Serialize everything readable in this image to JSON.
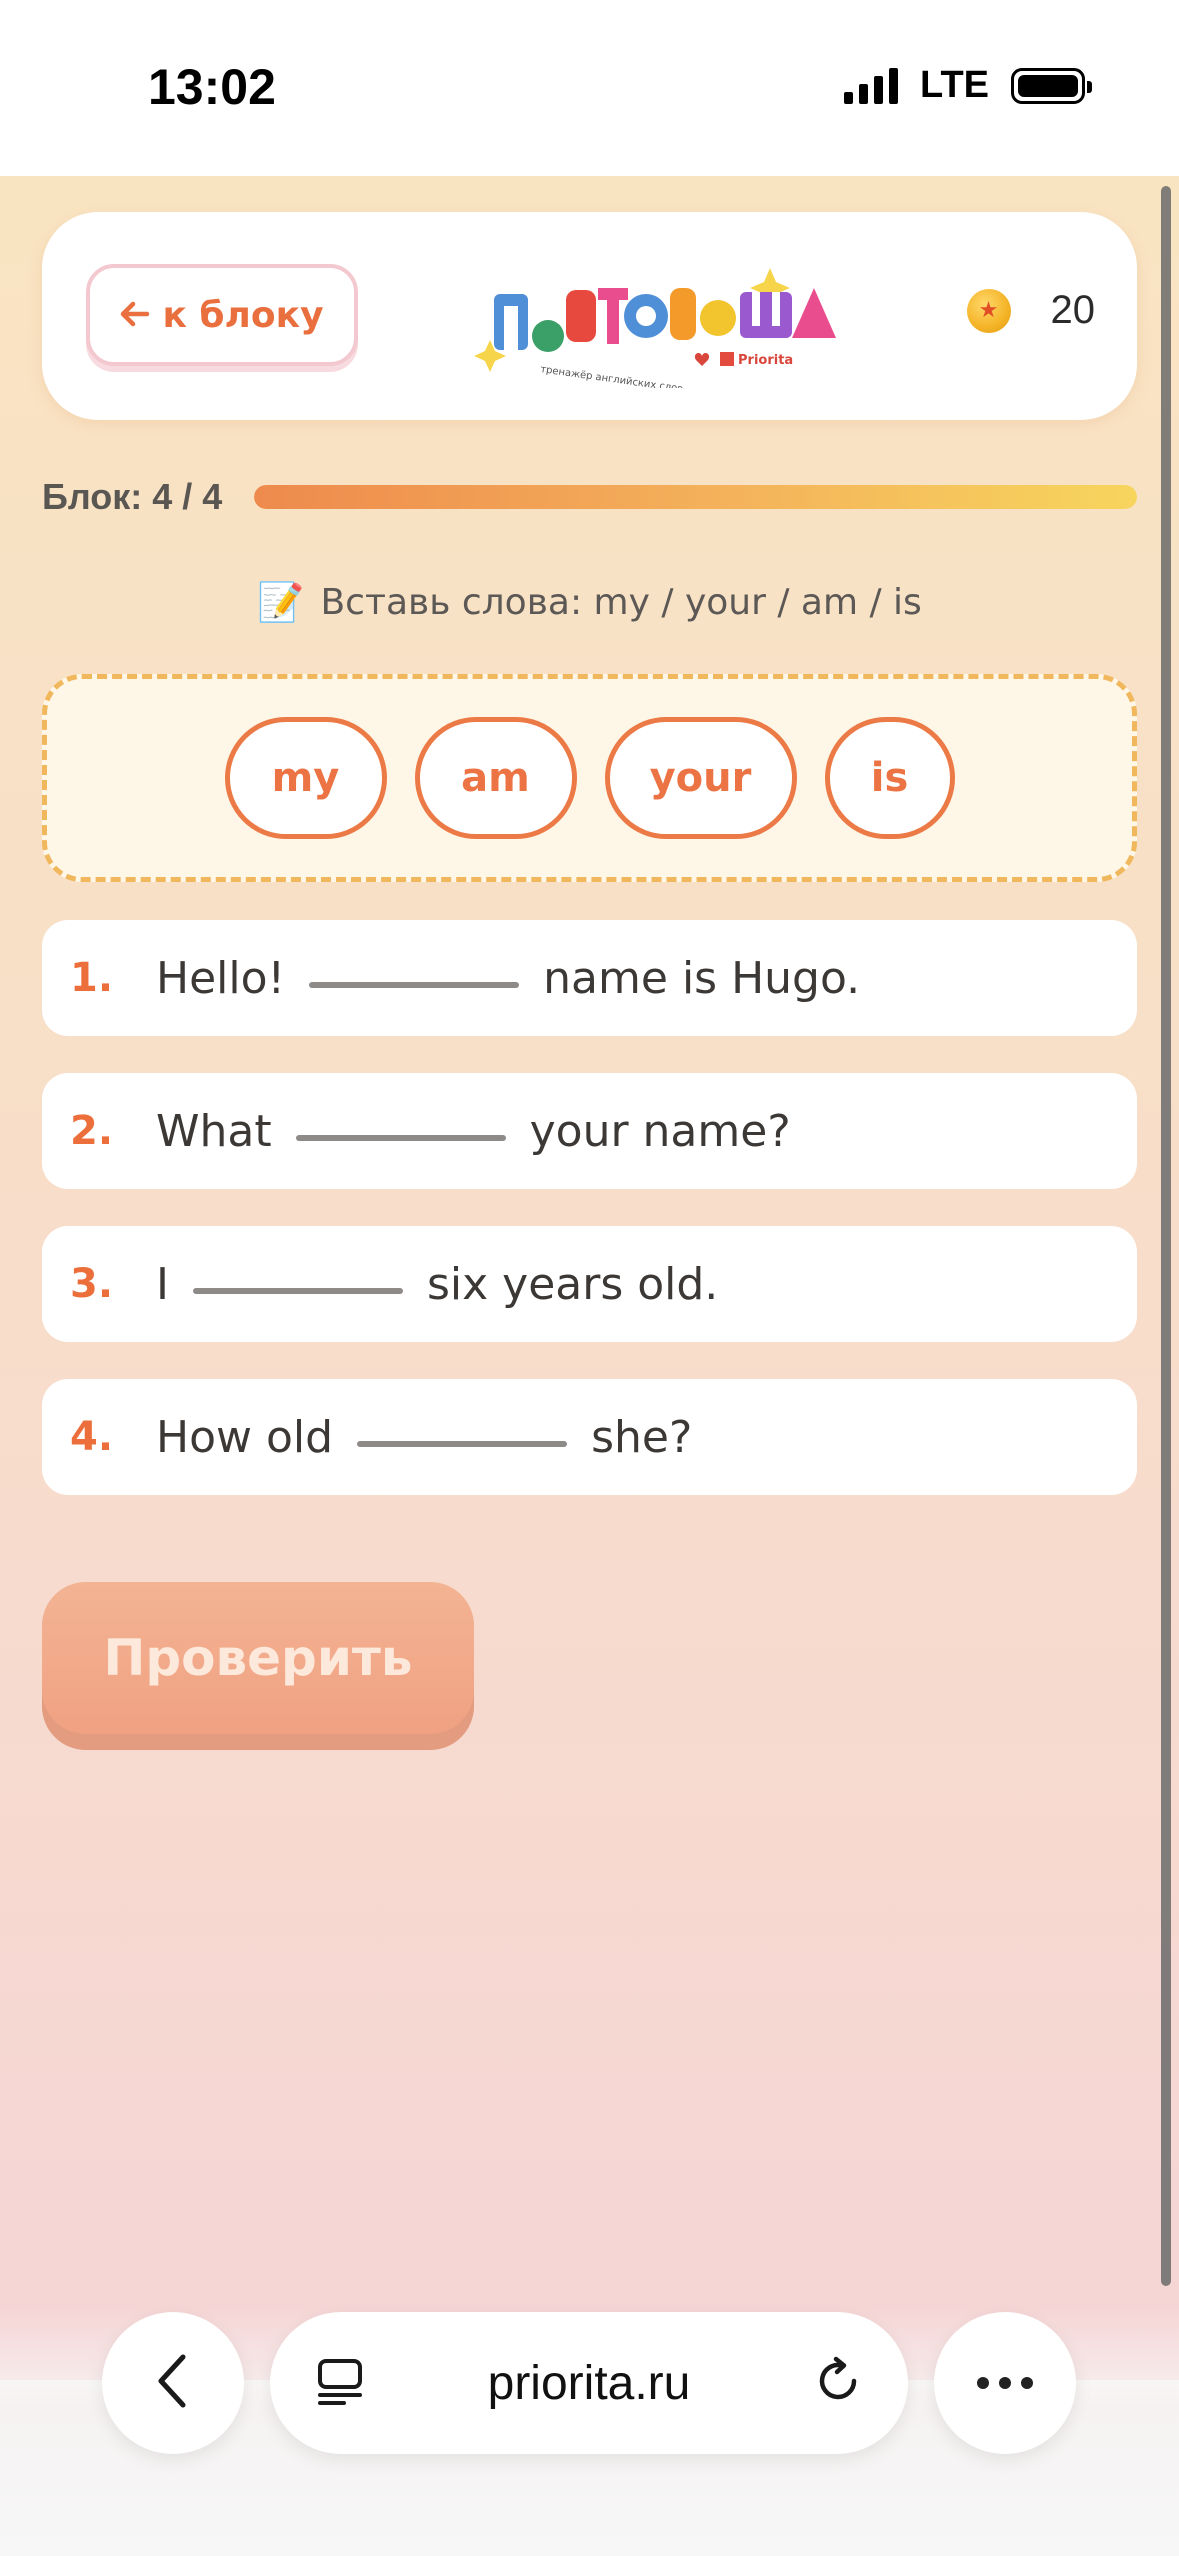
{
  "status_bar": {
    "time": "13:02",
    "network": "LTE"
  },
  "header": {
    "back_label": "к блоку",
    "logo_text": "ПОВТОРЮША",
    "coins": "20"
  },
  "progress": {
    "label": "Блок: 4 / 4",
    "fraction": 1.0
  },
  "instruction": "Вставь слова: my / your / am / is",
  "word_bank": [
    "my",
    "am",
    "your",
    "is"
  ],
  "sentences": [
    {
      "num": "1.",
      "before": "Hello!",
      "after": "name is Hugo."
    },
    {
      "num": "2.",
      "before": "What",
      "after": "your name?"
    },
    {
      "num": "3.",
      "before": "I",
      "after": "six years old."
    },
    {
      "num": "4.",
      "before": "How old",
      "after": "she?"
    }
  ],
  "check_button": "Проверить",
  "browser": {
    "url": "priorita.ru"
  },
  "colors": {
    "accent": "#ec7343",
    "chip_border": "#ec7a46",
    "wordbank_border": "#f1b75d",
    "button": "#f0a182"
  }
}
